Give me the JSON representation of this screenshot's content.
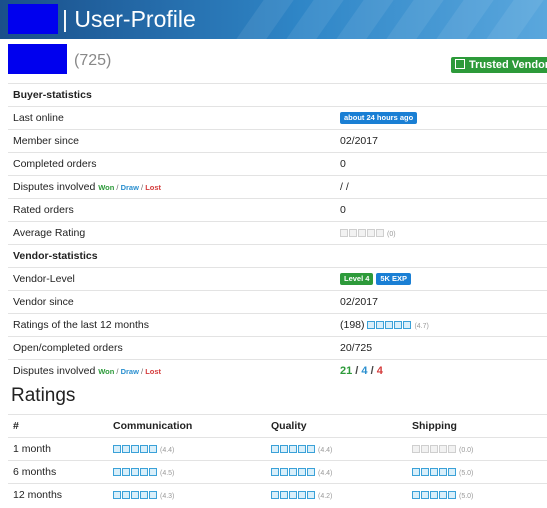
{
  "header": {
    "title": "| User-Profile",
    "review_count": "(725)",
    "trusted_badge": "Trusted Vendor"
  },
  "buyer": {
    "section_label": "Buyer-statistics",
    "last_online_label": "Last online",
    "last_online_value": "about 24 hours ago",
    "member_since_label": "Member since",
    "member_since_value": "02/2017",
    "completed_orders_label": "Completed orders",
    "completed_orders_value": "0",
    "disputes_label": "Disputes involved",
    "disputes_won": "Won",
    "disputes_draw": "Draw",
    "disputes_lost": "Lost",
    "disputes_value": "/ /",
    "rated_orders_label": "Rated orders",
    "rated_orders_value": "0",
    "avg_rating_label": "Average Rating",
    "avg_rating_value": "(0)",
    "avg_rating_stars": 0
  },
  "vendor": {
    "section_label": "Vendor-statistics",
    "level_label": "Vendor-Level",
    "level_badge": "Level 4",
    "exp_badge": "5K EXP",
    "since_label": "Vendor since",
    "since_value": "02/2017",
    "ratings12_label": "Ratings of the last 12 months",
    "ratings12_count": "(198)",
    "ratings12_score": "(4.7)",
    "ratings12_stars": 5,
    "open_completed_label": "Open/completed orders",
    "open_completed_value": "20/725",
    "disputes_label": "Disputes involved",
    "disputes_won": "Won",
    "disputes_draw": "Draw",
    "disputes_lost": "Lost",
    "disputes_won_count": "21",
    "disputes_draw_count": "4",
    "disputes_lost_count": "4"
  },
  "ratings": {
    "title": "Ratings",
    "columns": [
      "#",
      "Communication",
      "Quality",
      "Shipping"
    ],
    "rows": [
      {
        "period": "1 month",
        "communication": "(4.4)",
        "quality": "(4.4)",
        "shipping": "(0.0)",
        "communication_stars": 5,
        "quality_stars": 5,
        "shipping_stars": 0
      },
      {
        "period": "6 months",
        "communication": "(4.5)",
        "quality": "(4.4)",
        "shipping": "(5.0)",
        "communication_stars": 5,
        "quality_stars": 5,
        "shipping_stars": 5
      },
      {
        "period": "12 months",
        "communication": "(4.3)",
        "quality": "(4.2)",
        "shipping": "(5.0)",
        "communication_stars": 5,
        "quality_stars": 5,
        "shipping_stars": 5
      }
    ]
  }
}
